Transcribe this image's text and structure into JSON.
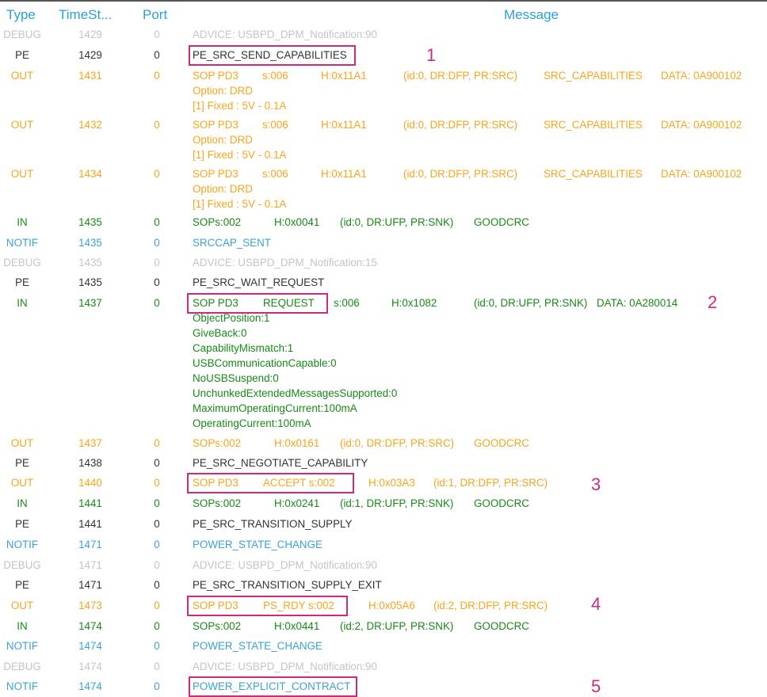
{
  "columns": {
    "type": "Type",
    "time": "TimeSt...",
    "port": "Port",
    "message": "Message"
  },
  "colors": {
    "header": "#2aa0d8",
    "debug": "#c4c4c4",
    "pe": "#333333",
    "out": "#f7a51c",
    "in": "#178a17",
    "notif": "#3aa3d6",
    "annotation": "#cc2a7c"
  },
  "rows": [
    {
      "type": "DEBUG",
      "time": "1429",
      "port": "0",
      "segs": [
        "ADVICE: USBPD_DPM_Notification:90"
      ]
    },
    {
      "type": "PE",
      "time": "1429",
      "port": "0",
      "segs": [
        "PE_SRC_SEND_CAPABILITIES"
      ]
    },
    {
      "type": "OUT",
      "time": "1431",
      "port": "0",
      "segs": [
        "SOP PD3",
        "s:006",
        "H:0x11A1",
        "(id:0, DR:DFP, PR:SRC)",
        "SRC_CAPABILITIES",
        "DATA: 0A900102"
      ],
      "extra": [
        "Option:  DRD",
        " [1] Fixed : 5V - 0.1A"
      ]
    },
    {
      "type": "OUT",
      "time": "1432",
      "port": "0",
      "segs": [
        "SOP PD3",
        "s:006",
        "H:0x11A1",
        "(id:0, DR:DFP, PR:SRC)",
        "SRC_CAPABILITIES",
        "DATA: 0A900102"
      ],
      "extra": [
        "Option:  DRD",
        " [1] Fixed : 5V - 0.1A"
      ]
    },
    {
      "type": "OUT",
      "time": "1434",
      "port": "0",
      "segs": [
        "SOP PD3",
        "s:006",
        "H:0x11A1",
        "(id:0, DR:DFP, PR:SRC)",
        "SRC_CAPABILITIES",
        "DATA: 0A900102"
      ],
      "extra": [
        "Option:  DRD",
        " [1] Fixed : 5V - 0.1A"
      ]
    },
    {
      "type": "IN",
      "time": "1435",
      "port": "0",
      "segs": [
        "SOPs:002",
        "H:0x0041",
        "(id:0, DR:UFP, PR:SNK)",
        "GOODCRC"
      ]
    },
    {
      "type": "NOTIF",
      "time": "1435",
      "port": "0",
      "segs": [
        "SRCCAP_SENT"
      ]
    },
    {
      "type": "DEBUG",
      "time": "1435",
      "port": "0",
      "segs": [
        "ADVICE: USBPD_DPM_Notification:15"
      ]
    },
    {
      "type": "PE",
      "time": "1435",
      "port": "0",
      "segs": [
        "PE_SRC_WAIT_REQUEST"
      ]
    },
    {
      "type": "IN",
      "time": "1437",
      "port": "0",
      "segs": [
        "SOP PD3",
        "REQUEST",
        "s:006",
        "H:0x1082",
        "(id:0, DR:UFP, PR:SNK)",
        "DATA: 0A280014"
      ],
      "extra": [
        "ObjectPosition:1",
        "GiveBack:0",
        "CapabilityMismatch:1",
        "USBCommunicationCapable:0",
        "NoUSBSuspend:0",
        "UnchunkedExtendedMessagesSupported:0",
        "MaximumOperatingCurrent:100mA",
        "OperatingCurrent:100mA"
      ]
    },
    {
      "type": "OUT",
      "time": "1437",
      "port": "0",
      "segs": [
        "SOPs:002",
        "H:0x0161",
        "(id:0, DR:DFP, PR:SRC)",
        "GOODCRC"
      ]
    },
    {
      "type": "PE",
      "time": "1438",
      "port": "0",
      "segs": [
        "PE_SRC_NEGOTIATE_CAPABILITY"
      ]
    },
    {
      "type": "OUT",
      "time": "1440",
      "port": "0",
      "segs": [
        "SOP PD3",
        "ACCEPT s:002",
        "H:0x03A3",
        "(id:1, DR:DFP, PR:SRC)"
      ]
    },
    {
      "type": "IN",
      "time": "1441",
      "port": "0",
      "segs": [
        "SOPs:002",
        "H:0x0241",
        "(id:1, DR:UFP, PR:SNK)",
        "GOODCRC"
      ]
    },
    {
      "type": "PE",
      "time": "1441",
      "port": "0",
      "segs": [
        "PE_SRC_TRANSITION_SUPPLY"
      ]
    },
    {
      "type": "NOTIF",
      "time": "1471",
      "port": "0",
      "segs": [
        "POWER_STATE_CHANGE"
      ]
    },
    {
      "type": "DEBUG",
      "time": "1471",
      "port": "0",
      "segs": [
        "ADVICE: USBPD_DPM_Notification:90"
      ]
    },
    {
      "type": "PE",
      "time": "1471",
      "port": "0",
      "segs": [
        "PE_SRC_TRANSITION_SUPPLY_EXIT"
      ]
    },
    {
      "type": "OUT",
      "time": "1473",
      "port": "0",
      "segs": [
        "SOP PD3",
        "PS_RDY  s:002",
        "H:0x05A6",
        "(id:2, DR:DFP, PR:SRC)"
      ]
    },
    {
      "type": "IN",
      "time": "1474",
      "port": "0",
      "segs": [
        "SOPs:002",
        "H:0x0441",
        "(id:2, DR:UFP, PR:SNK)",
        "GOODCRC"
      ]
    },
    {
      "type": "NOTIF",
      "time": "1474",
      "port": "0",
      "segs": [
        "POWER_STATE_CHANGE"
      ]
    },
    {
      "type": "DEBUG",
      "time": "1474",
      "port": "0",
      "segs": [
        "ADVICE: USBPD_DPM_Notification:90"
      ]
    },
    {
      "type": "NOTIF",
      "time": "1474",
      "port": "0",
      "segs": [
        "POWER_EXPLICIT_CONTRACT"
      ]
    }
  ],
  "annotations": [
    "1",
    "2",
    "3",
    "4",
    "5"
  ]
}
